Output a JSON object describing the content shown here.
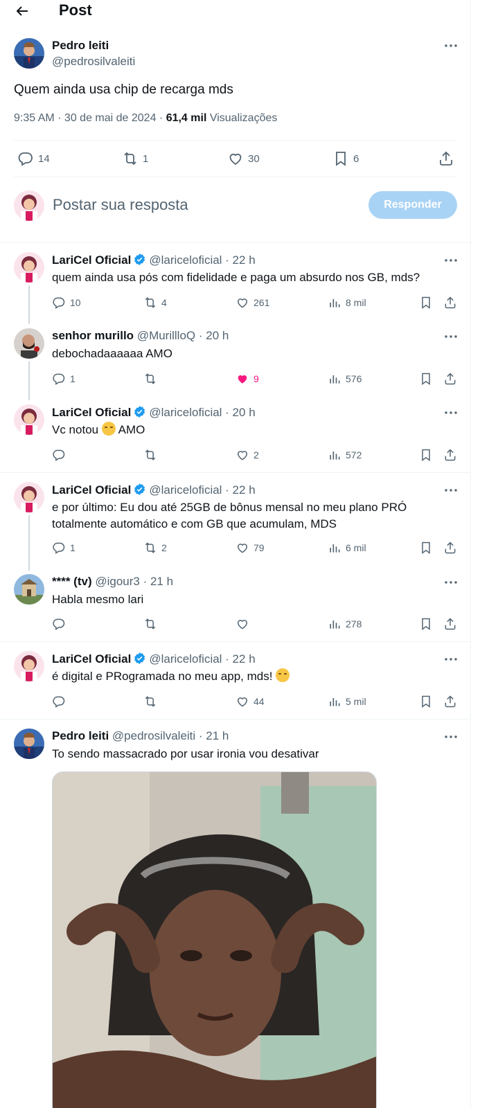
{
  "header": {
    "title": "Post"
  },
  "main_post": {
    "author_name": "Pedro leiti",
    "handle": "@pedrosilvaleiti",
    "text": "Quem ainda usa chip de recarga mds",
    "time": "9:35 AM · 30 de mai de 2024 · ",
    "views_count": "61,4 mil",
    "views_label": " Visualizações",
    "replies": "14",
    "reposts": "1",
    "likes": "30",
    "bookmarks": "6"
  },
  "composer": {
    "placeholder": "Postar sua resposta",
    "button_label": "Responder",
    "button_color": "#a9d3f5"
  },
  "replies": [
    {
      "name": "LariCel Oficial",
      "verified": true,
      "handle": "@lariceloficial · 22 h",
      "text": "quem ainda usa pós com fidelidade e paga um absurdo nos GB, mds?",
      "replies": "10",
      "reposts": "4",
      "likes": "261",
      "views": "8 mil"
    },
    {
      "name": "senhor murillo",
      "verified": false,
      "handle": "@MurillloQ · 20 h",
      "text": "debochadaaaaaa AMO",
      "replies": "1",
      "reposts": "",
      "likes": "9",
      "liked": true,
      "views": "576"
    },
    {
      "name": "LariCel Oficial",
      "verified": true,
      "handle": "@lariceloficial · 20 h",
      "text_before_emoji": "Vc notou ",
      "emoji": "grinning-sweat-emoji",
      "text_after_emoji": " AMO",
      "replies": "",
      "reposts": "",
      "likes": "2",
      "views": "572"
    },
    {
      "name": "LariCel Oficial",
      "verified": true,
      "handle": "@lariceloficial · 22 h",
      "text": "e por último: Eu dou até 25GB de bônus mensal no meu plano PRÓ totalmente automático e com GB que acumulam, MDS",
      "replies": "1",
      "reposts": "2",
      "likes": "79",
      "views": "6 mil"
    },
    {
      "name": "**** (tv)",
      "verified": false,
      "handle": "@igour3 · 21 h",
      "text": "Habla mesmo lari",
      "replies": "",
      "reposts": "",
      "likes": "",
      "views": "278"
    },
    {
      "name": "LariCel Oficial",
      "verified": true,
      "handle": "@lariceloficial · 22 h",
      "text_before_emoji": "é digital e PRogramada no meu app, mds! ",
      "emoji": "relieved-face-emoji",
      "text_after_emoji": "",
      "replies": "",
      "reposts": "",
      "likes": "44",
      "views": "5 mil"
    },
    {
      "name": "Pedro leiti",
      "verified": false,
      "handle": "@pedrosilvaleiti · 21 h",
      "text": "To sendo massacrado por usar ironia vou desativar"
    }
  ],
  "colors": {
    "accent": "#1d9bf0",
    "like": "#f91880",
    "secondary_text": "#536471"
  }
}
